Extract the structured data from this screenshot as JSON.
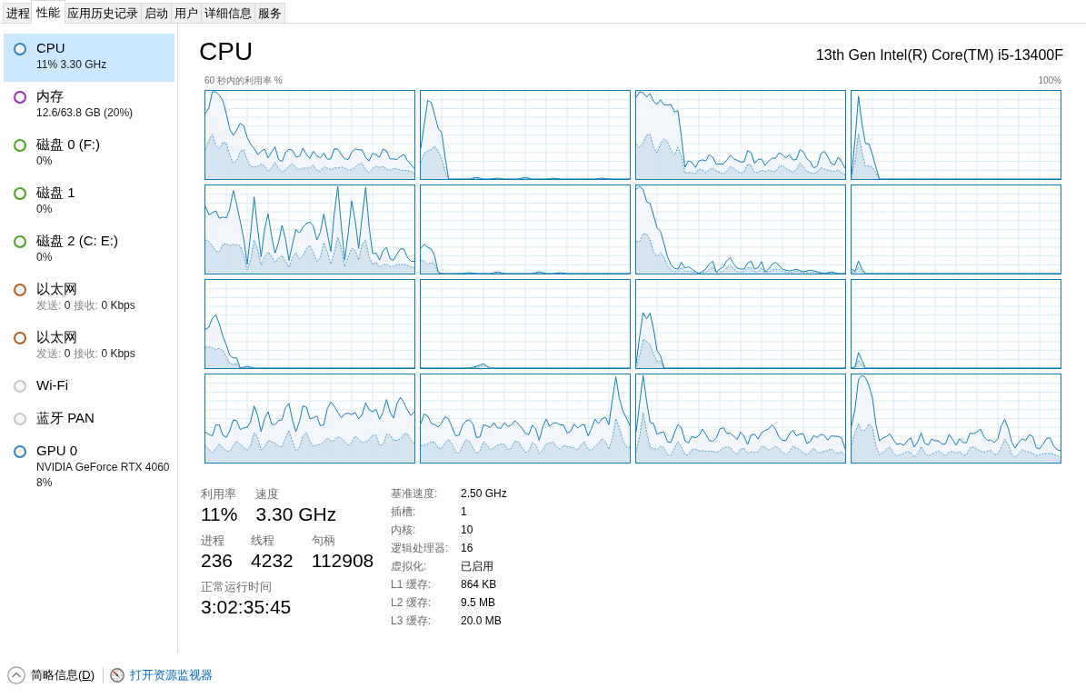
{
  "tabs": [
    {
      "label": "进程",
      "selected": false
    },
    {
      "label": "性能",
      "selected": true
    },
    {
      "label": "应用历史记录",
      "selected": false
    },
    {
      "label": "启动",
      "selected": false
    },
    {
      "label": "用户",
      "selected": false
    },
    {
      "label": "详细信息",
      "selected": false
    },
    {
      "label": "服务",
      "selected": false
    }
  ],
  "sidebar": {
    "items": [
      {
        "kind": "plain",
        "name": "CPU",
        "lines": [
          "11% 3.30 GHz"
        ],
        "color": "#2f84c4",
        "selected": true
      },
      {
        "kind": "plain",
        "name": "内存",
        "lines": [
          "12.6/63.8 GB (20%)"
        ],
        "color": "#9a2fc0",
        "selected": false
      },
      {
        "kind": "plain",
        "name": "磁盘 0 (F:)",
        "lines": [
          "0%"
        ],
        "color": "#4aa51a",
        "selected": false
      },
      {
        "kind": "plain",
        "name": "磁盘 1",
        "lines": [
          "0%"
        ],
        "color": "#4aa51a",
        "selected": false
      },
      {
        "kind": "plain",
        "name": "磁盘 2 (C: E:)",
        "lines": [
          "0%"
        ],
        "color": "#4aa51a",
        "selected": false
      },
      {
        "kind": "network",
        "name": "以太网",
        "rates": [
          {
            "label": "发送:",
            "value": "0"
          },
          {
            "label": "接收:",
            "value": "0 Kbps"
          }
        ],
        "color": "#b0601e",
        "selected": false
      },
      {
        "kind": "network",
        "name": "以太网",
        "rates": [
          {
            "label": "发送:",
            "value": "0"
          },
          {
            "label": "接收:",
            "value": "0 Kbps"
          }
        ],
        "color": "#b0601e",
        "selected": false
      },
      {
        "kind": "plain",
        "name": "Wi-Fi",
        "color": "#c6c6c6",
        "selected": false
      },
      {
        "kind": "plain",
        "name": "蓝牙 PAN",
        "color": "#c6c6c6",
        "selected": false
      },
      {
        "kind": "plain",
        "name": "GPU 0",
        "lines": [
          "NVIDIA GeForce RTX 4060",
          "8%"
        ],
        "color": "#2f84c4",
        "selected": false
      }
    ]
  },
  "main": {
    "title": "CPU",
    "model": "13th Gen Intel(R) Core(TM) i5-13400F",
    "graph_caption": "60 秒内的利用率 %",
    "graph_max": "100%",
    "stat_rows": [
      {
        "items": [
          {
            "label": "利用率",
            "value": "11%"
          },
          {
            "label": "速度",
            "value": "3.30 GHz"
          }
        ]
      },
      {
        "items": [
          {
            "label": "进程",
            "value": "236"
          },
          {
            "label": "线程",
            "value": "4232"
          },
          {
            "label": "句柄",
            "value": "112908"
          }
        ]
      },
      {
        "items": [
          {
            "label": "正常运行时间",
            "value": "3:02:35:45"
          }
        ]
      }
    ],
    "specs": [
      {
        "label": "基准速度:",
        "value": "2.50 GHz"
      },
      {
        "label": "插槽:",
        "value": "1"
      },
      {
        "label": "内核:",
        "value": "10"
      },
      {
        "label": "逻辑处理器:",
        "value": "16"
      },
      {
        "label": "虚拟化:",
        "value": "已启用"
      },
      {
        "label": "L1 缓存:",
        "value": "864 KB"
      },
      {
        "label": "L2 缓存:",
        "value": "9.5 MB"
      },
      {
        "label": "L3 缓存:",
        "value": "20.0 MB"
      }
    ]
  },
  "footer": {
    "details_toggle": {
      "text_before": "简略信息(",
      "access_key": "D",
      "text_after": ")"
    },
    "link": "打开资源监视器"
  }
}
